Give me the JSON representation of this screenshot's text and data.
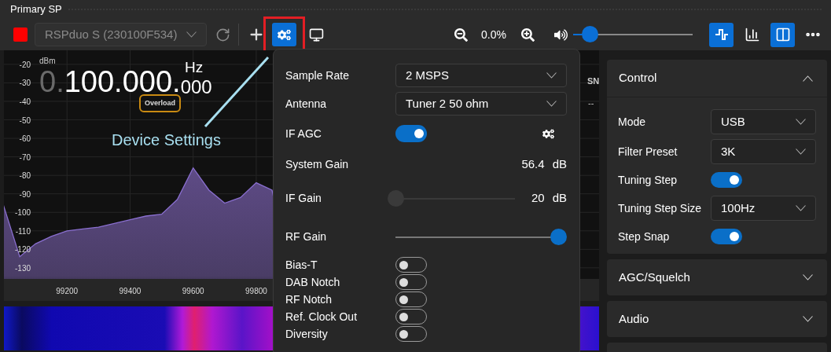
{
  "title": "Primary SP",
  "toolbar": {
    "device_select": {
      "value": "RSPduo S (230100F534)",
      "disabled": true
    },
    "device_buttons": [
      {
        "kind": "settings",
        "selected": true,
        "highlighted": true
      },
      {
        "kind": "display",
        "selected": false,
        "highlighted": false
      }
    ],
    "zoom": "0.0%",
    "volume": {
      "level": 0.14
    },
    "view_buttons": [
      {
        "kind": "waveform",
        "selected": true
      },
      {
        "kind": "bars",
        "selected": false
      },
      {
        "kind": "split",
        "selected": true
      }
    ]
  },
  "frequency": {
    "leading": "0.",
    "main": "100.000.",
    "fine": "000",
    "unit": "Hz"
  },
  "overload_badge": "Overload",
  "snr": {
    "label": "SN",
    "value": "--"
  },
  "spectrum": {
    "chart_data": {
      "type": "area",
      "ylabel": "dBm",
      "grid": true,
      "xlim": [
        99000,
        100887
      ],
      "ylim": [
        -136,
        -12.4
      ],
      "x": [
        99000,
        99050,
        99100,
        99150,
        99200,
        99250,
        99300,
        99350,
        99400,
        99450,
        99500,
        99550,
        99600,
        99650,
        99700,
        99750,
        99800,
        99850
      ],
      "values": [
        -97,
        -124,
        -117,
        -113,
        -110,
        -109,
        -108,
        -106,
        -104,
        -102,
        -101,
        -93,
        -76,
        -88,
        -95,
        -92,
        -84,
        -88
      ],
      "xticks": [
        99200,
        99400,
        99600,
        99800
      ],
      "yticks": [
        -20,
        -30,
        -40,
        -50,
        -60,
        -70,
        -80,
        -90,
        -100,
        -110,
        -120,
        -130
      ]
    }
  },
  "annotation": "Device Settings",
  "device_settings": {
    "rows": [
      {
        "kind": "select",
        "label": "Sample Rate",
        "value": "2 MSPS"
      },
      {
        "kind": "select",
        "label": "Antenna",
        "value": "Tuner 2 50 ohm"
      },
      {
        "kind": "toggle",
        "label": "IF AGC",
        "on": true
      },
      {
        "kind": "reading",
        "label": "System Gain",
        "value": "56.4",
        "unit": "dB"
      },
      {
        "kind": "slider",
        "label": "IF Gain",
        "level": 0,
        "disabled": true,
        "value": "20",
        "unit": "dB"
      },
      {
        "kind": "slider",
        "label": "RF Gain",
        "level": 1,
        "disabled": false
      }
    ],
    "switches": [
      {
        "label": "Bias-T",
        "on": false
      },
      {
        "label": "DAB Notch",
        "on": false
      },
      {
        "label": "RF Notch",
        "on": false
      },
      {
        "label": "Ref. Clock Out",
        "on": false
      },
      {
        "label": "Diversity",
        "on": false
      }
    ]
  },
  "control_panel": {
    "sections": [
      {
        "title": "Control",
        "expanded": true,
        "rows": [
          {
            "kind": "select",
            "label": "Mode",
            "value": "USB"
          },
          {
            "kind": "select",
            "label": "Filter Preset",
            "value": "3K"
          },
          {
            "kind": "toggle",
            "label": "Tuning Step",
            "on": true
          },
          {
            "kind": "select",
            "label": "Tuning Step Size",
            "value": "100Hz"
          },
          {
            "kind": "toggle",
            "label": "Step Snap",
            "on": true
          }
        ]
      },
      {
        "title": "AGC/Squelch",
        "expanded": false
      },
      {
        "title": "Audio",
        "expanded": false
      }
    ]
  }
}
